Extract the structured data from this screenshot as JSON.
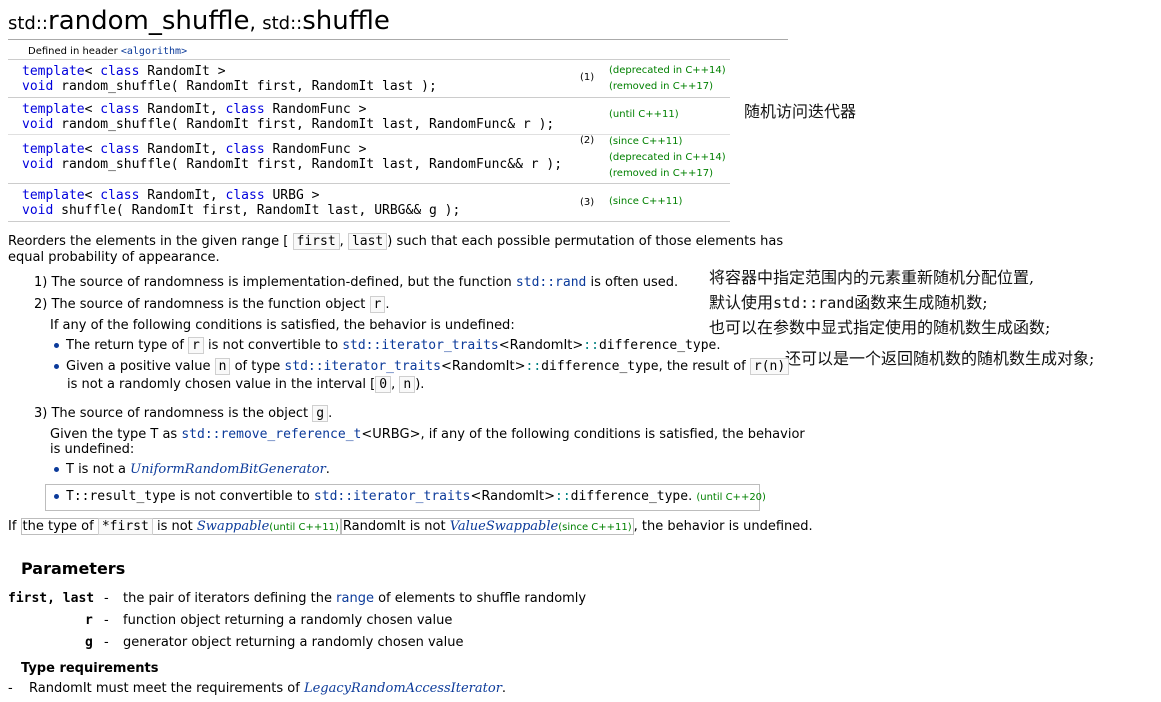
{
  "title": {
    "ns1": "std::",
    "name1": "random_shuffle",
    "sep": ", ",
    "ns2": "std::",
    "name2": "shuffle"
  },
  "defined_in": {
    "label": "Defined in header ",
    "header": "<algorithm>"
  },
  "decls": {
    "d1": {
      "l1_kw": "template",
      "l1_a": "< ",
      "l1_kw2": "class",
      "l1_b": " RandomIt >",
      "l2_kw": "void",
      "l2_b": " random_shuffle( RandomIt first, RandomIt last );",
      "num": "(1)",
      "note1": "(deprecated in C++14)",
      "note2": "(removed in C++17)"
    },
    "d2a": {
      "l1_kw": "template",
      "l1_a": "< ",
      "l1_kw2": "class",
      "l1_b": " RandomIt, ",
      "l1_kw3": "class",
      "l1_c": " RandomFunc >",
      "l2_kw": "void",
      "l2_b": " random_shuffle( RandomIt first, RandomIt last, RandomFunc& r );",
      "note1": "(until C++11)"
    },
    "d2b": {
      "l1_kw": "template",
      "l1_a": "< ",
      "l1_kw2": "class",
      "l1_b": " RandomIt, ",
      "l1_kw3": "class",
      "l1_c": " RandomFunc >",
      "l2_kw": "void",
      "l2_b": " random_shuffle( RandomIt first, RandomIt last, RandomFunc&& r );",
      "num": "(2)",
      "note1": "(since C++11)",
      "note2": "(deprecated in C++14)",
      "note3": "(removed in C++17)"
    },
    "d3": {
      "l1_kw": "template",
      "l1_a": "< ",
      "l1_kw2": "class",
      "l1_b": " RandomIt, ",
      "l1_kw3": "class",
      "l1_c": " URBG >",
      "l2_kw": "void",
      "l2_b": " shuffle( RandomIt first, RandomIt last, URBG&& g );",
      "num": "(3)",
      "note1": "(since C++11)"
    }
  },
  "annotations": {
    "a1": "随机访问迭代器",
    "a2": "将容器中指定范围内的元素重新随机分配位置,",
    "a3_pre": "默认使用",
    "a3_code": "std::rand",
    "a3_post": "函数来生成随机数;",
    "a4": "也可以在参数中显式指定使用的随机数生成函数;",
    "a5": "还可以是一个返回随机数的随机数生成对象;"
  },
  "desc": {
    "p1_a": "Reorders the elements in the given range [",
    "p1_first": "first",
    "p1_comma": ",",
    "p1_last": "last",
    "p1_b": ") such that each possible permutation of those elements has",
    "p1_c": "equal probability of appearance.",
    "i1_a": "1) The source of randomness is implementation-defined, but the function ",
    "i1_link": "std::rand",
    "i1_b": " is often used.",
    "i2_a": "2) The source of randomness is the function object ",
    "i2_r": "r",
    "i2_b": ".",
    "i2_cond": "If any of the following conditions is satisfied, the behavior is undefined:",
    "b1_a": "The return type of ",
    "b1_r": "r",
    "b1_b": " is not convertible to ",
    "b1_link": "std::iterator_traits",
    "b1_c": "<RandomIt>",
    "b1_d": "::difference_type",
    "b1_e": ".",
    "b2_a": "Given a positive value ",
    "b2_n": "n",
    "b2_b": " of type ",
    "b2_link": "std::iterator_traits",
    "b2_c": "<RandomIt>",
    "b2_d": "::difference_type",
    "b2_e": ", the result of ",
    "b2_rn": "r(n)",
    "b2_f": "is not a randomly chosen value in the interval [",
    "b2_zero": "0",
    "b2_comma": ",",
    "b2_n2": "n",
    "b2_g": ").",
    "i3_a": "3) The source of randomness is the object ",
    "i3_g": "g",
    "i3_b": ".",
    "i3_given_a": "Given the type T as ",
    "i3_given_link": "std::remove_reference_t",
    "i3_given_b": "<URBG>, if any of the following conditions is satisfied, the behavior",
    "i3_given_c": "is undefined:",
    "b3_a": "T is not a ",
    "b3_link": "UniformRandomBitGenerator",
    "b3_b": ".",
    "b4_a": "T::result_type",
    "b4_b": " is not convertible to ",
    "b4_link": "std::iterator_traits",
    "b4_c": "<RandomIt>",
    "b4_d": "::difference_type",
    "b4_e": ". ",
    "b4_note": "(until C++20)",
    "p2_if": "If ",
    "p2_a": "the type of ",
    "p2_first": "*first",
    "p2_b": " is not ",
    "p2_link1": "Swappable",
    "p2_note1": "(until C++11)",
    "p2_c": "RandomIt is not ",
    "p2_link2": "ValueSwappable",
    "p2_note2": "(since C++11)",
    "p2_d": ", the behavior is undefined."
  },
  "parameters": {
    "heading": "Parameters",
    "rows": [
      {
        "name": "first, last",
        "dash": "-",
        "a": "the pair of iterators defining the ",
        "link": "range",
        "b": " of elements to shuffle randomly"
      },
      {
        "name": "r",
        "dash": "-",
        "a": "function object returning a randomly chosen value"
      },
      {
        "name": "g",
        "dash": "-",
        "a": "generator object returning a randomly chosen value"
      }
    ],
    "type_req": "Type requirements",
    "req_dash": "-",
    "req_a": "RandomIt must meet the requirements of ",
    "req_link": "LegacyRandomAccessIterator",
    "req_b": "."
  },
  "colors": {
    "keyword": "#0000dd",
    "symbol": "#008080",
    "version_note": "#008000",
    "link": "#0b3a9a"
  }
}
